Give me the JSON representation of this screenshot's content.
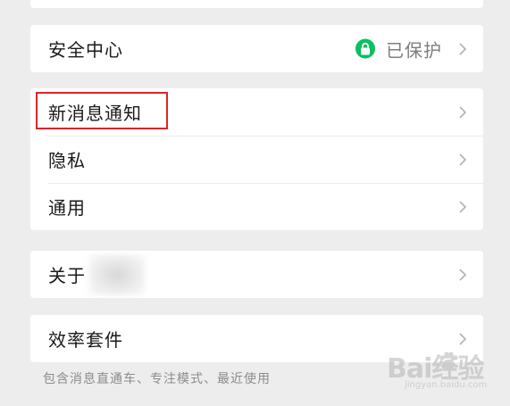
{
  "cards": {
    "security": {
      "label": "安全中心",
      "status": "已保护"
    },
    "notifications": {
      "items": [
        {
          "label": "新消息通知"
        },
        {
          "label": "隐私"
        },
        {
          "label": "通用"
        }
      ]
    },
    "about": {
      "label": "关于"
    },
    "efficiency": {
      "label": "效率套件"
    }
  },
  "footnote": "包含消息直通车、专注模式、最近使用",
  "watermark": {
    "main": "Bai经验",
    "sub": "jingyan.baidu.com"
  },
  "colors": {
    "background": "#ededed",
    "card": "#ffffff",
    "accent": "#07c160",
    "highlight": "#d9262c"
  },
  "icons": {
    "lock": "lock-icon",
    "chevron": "chevron-right-icon",
    "watermark": "baidu-paw-icon"
  }
}
